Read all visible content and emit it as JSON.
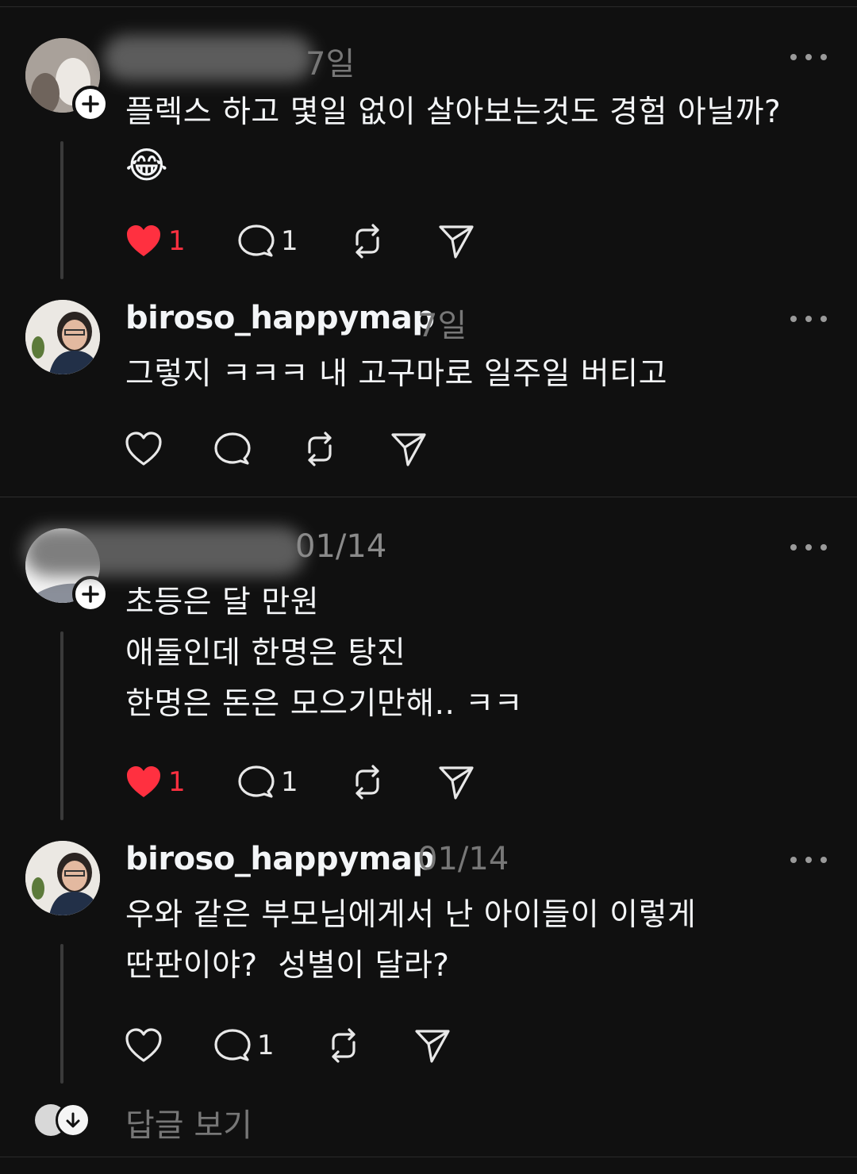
{
  "comments": [
    {
      "time": "7일",
      "text": "플렉스 하고 몇일 없이 살아보는것도 경험 아닐까?",
      "emoji": "😂",
      "likes": "1",
      "replies": "1",
      "liked": true
    },
    {
      "username": "biroso_happymap",
      "time": "7일",
      "text": "그렇지 ㅋㅋㅋ 내 고구마로 일주일 버티고"
    },
    {
      "time": "01/14",
      "lines": [
        "초등은 달 만원",
        "애둘인데 한명은 탕진",
        "한명은 돈은 모으기만해.. ㅋㅋ"
      ],
      "likes": "1",
      "replies": "1",
      "liked": true
    },
    {
      "username": "biroso_happymap",
      "time": "01/14",
      "lines": [
        "우와 같은 부모님에게서 난 아이들이 이렇게",
        "딴판이야?  성별이 달라?"
      ],
      "replies": "1"
    }
  ],
  "view_replies_label": "답글 보기",
  "colors": {
    "background": "#101010",
    "like_red": "#ff3040",
    "muted": "#777777"
  }
}
